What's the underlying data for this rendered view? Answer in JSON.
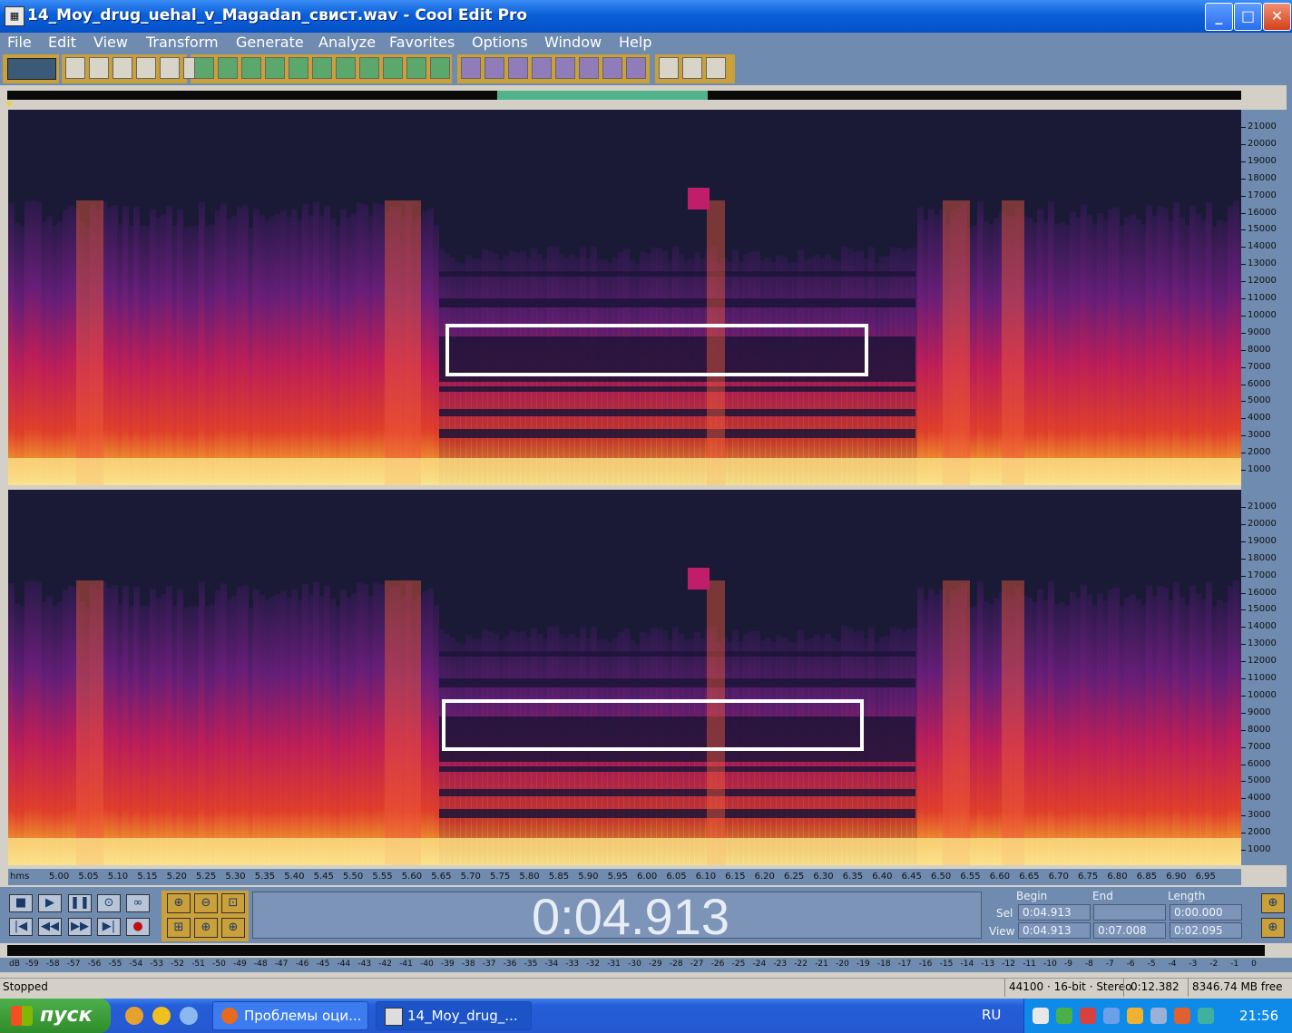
{
  "window": {
    "title": "14_Moy_drug_uehal_v_Magadan_свист.wav - Cool Edit Pro",
    "minimize": "_",
    "maximize": "□",
    "close": "✕"
  },
  "menu": [
    "File",
    "Edit",
    "View",
    "Transform",
    "Generate",
    "Analyze",
    "Favorites",
    "Options",
    "Window",
    "Help"
  ],
  "freq_ruler": [
    "21000",
    "20000",
    "19000",
    "18000",
    "17000",
    "16000",
    "15000",
    "14000",
    "13000",
    "12000",
    "11000",
    "10000",
    "9000",
    "8000",
    "7000",
    "6000",
    "5000",
    "4000",
    "3000",
    "2000",
    "1000"
  ],
  "time_ruler": {
    "unit": "hms",
    "labels": [
      "5.00",
      "5.05",
      "5.10",
      "5.15",
      "5.20",
      "5.25",
      "5.30",
      "5.35",
      "5.40",
      "5.45",
      "5.50",
      "5.55",
      "5.60",
      "5.65",
      "5.70",
      "5.75",
      "5.80",
      "5.85",
      "5.90",
      "5.95",
      "6.00",
      "6.05",
      "6.10",
      "6.15",
      "6.20",
      "6.25",
      "6.30",
      "6.35",
      "6.40",
      "6.45",
      "6.50",
      "6.55",
      "6.60",
      "6.65",
      "6.70",
      "6.75",
      "6.80",
      "6.85",
      "6.90",
      "6.95"
    ]
  },
  "transport": {
    "time": "0:04.913",
    "headers": {
      "begin": "Begin",
      "end": "End",
      "length": "Length"
    },
    "sel_label": "Sel",
    "view_label": "View",
    "sel": {
      "begin": "0:04.913",
      "end": "",
      "length": "0:00.000"
    },
    "view": {
      "begin": "0:04.913",
      "end": "0:07.008",
      "length": "0:02.095"
    }
  },
  "meter_scale": {
    "unit": "dB",
    "labels": [
      "-59",
      "-58",
      "-57",
      "-56",
      "-55",
      "-54",
      "-53",
      "-52",
      "-51",
      "-50",
      "-49",
      "-48",
      "-47",
      "-46",
      "-45",
      "-44",
      "-43",
      "-42",
      "-41",
      "-40",
      "-39",
      "-38",
      "-37",
      "-36",
      "-35",
      "-34",
      "-33",
      "-32",
      "-31",
      "-30",
      "-29",
      "-28",
      "-27",
      "-26",
      "-25",
      "-24",
      "-23",
      "-22",
      "-21",
      "-20",
      "-19",
      "-18",
      "-17",
      "-16",
      "-15",
      "-14",
      "-13",
      "-12",
      "-11",
      "-10",
      "-9",
      "-8",
      "-7",
      "-6",
      "-5",
      "-4",
      "-3",
      "-2",
      "-1",
      "0"
    ]
  },
  "status": {
    "state": "Stopped",
    "format": "44100 · 16-bit · Stereo",
    "duration": "0:12.382",
    "free": "8346.74 MB free"
  },
  "taskbar": {
    "start": "пуск",
    "tasks": [
      "Проблемы оци...",
      "14_Moy_drug_..."
    ],
    "lang": "RU",
    "clock": "21:56"
  },
  "colors": {
    "panel": "#6f8bb0",
    "spectro_bg": "#1b1a36",
    "highlight": "#ffffff"
  }
}
